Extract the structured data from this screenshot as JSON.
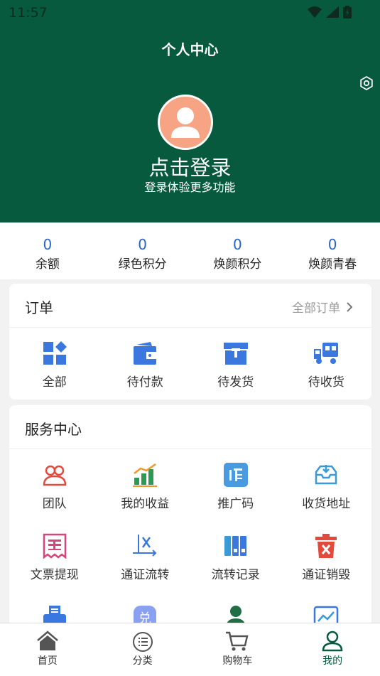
{
  "status_bar": {
    "time": "11:57"
  },
  "header": {
    "title": "个人中心",
    "login_title": "点击登录",
    "login_sub": "登录体验更多功能"
  },
  "stats": [
    {
      "value": "0",
      "label": "余额"
    },
    {
      "value": "0",
      "label": "绿色积分"
    },
    {
      "value": "0",
      "label": "焕颜积分"
    },
    {
      "value": "0",
      "label": "焕颜青春"
    }
  ],
  "orders": {
    "title": "订单",
    "all_label": "全部订单",
    "items": [
      {
        "label": "全部",
        "icon": "grid-icon"
      },
      {
        "label": "待付款",
        "icon": "wallet-icon"
      },
      {
        "label": "待发货",
        "icon": "package-icon"
      },
      {
        "label": "待收货",
        "icon": "truck-icon"
      }
    ]
  },
  "services": {
    "title": "服务中心",
    "items": [
      {
        "label": "团队",
        "icon": "team-icon"
      },
      {
        "label": "我的收益",
        "icon": "earnings-icon"
      },
      {
        "label": "推广码",
        "icon": "promo-code-icon"
      },
      {
        "label": "收货地址",
        "icon": "address-inbox-icon"
      },
      {
        "label": "文票提现",
        "icon": "ticket-icon"
      },
      {
        "label": "通证流转",
        "icon": "transfer-icon"
      },
      {
        "label": "流转记录",
        "icon": "records-icon"
      },
      {
        "label": "通证销毁",
        "icon": "trash-icon"
      }
    ]
  },
  "tabbar": [
    {
      "label": "首页",
      "icon": "home-icon"
    },
    {
      "label": "分类",
      "icon": "category-icon"
    },
    {
      "label": "购物车",
      "icon": "cart-icon"
    },
    {
      "label": "我的",
      "icon": "user-icon",
      "active": true
    }
  ],
  "colors": {
    "brand": "#075a3e",
    "accent_blue": "#2b64c8",
    "icon_blue": "#3a78e0",
    "red": "#e24b3c"
  }
}
